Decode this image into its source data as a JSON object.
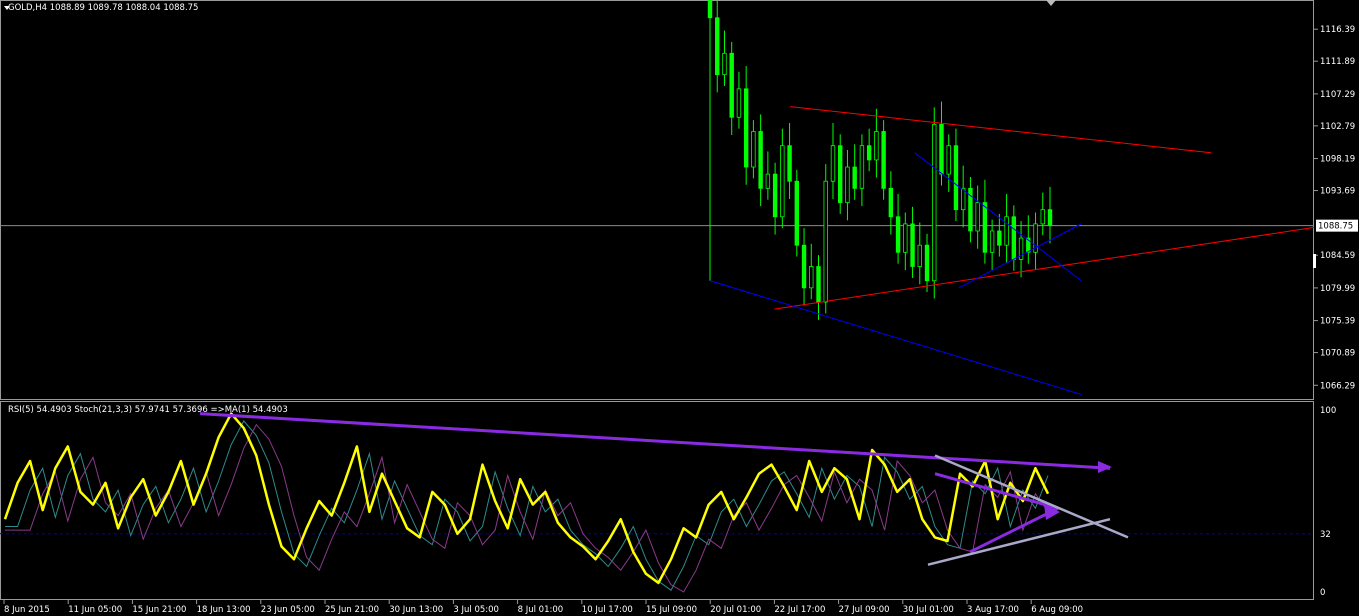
{
  "window": {
    "symbol_label": "GOLD,H4",
    "ohlc": "1088.89 1089.78 1088.04 1088.75",
    "menu_icon": "triangle-down-icon"
  },
  "indicator": {
    "header": "RSI(5) 54.4903  Stoch(21,3,3) 57.9741 57.3696  =>MA(1) 54.4903"
  },
  "colors": {
    "background": "#000000",
    "candle": "#00ff00",
    "rsi": "#ffff00",
    "trend_red": "#ff0000",
    "trend_blue": "#0000ff",
    "trend_purple": "#8a2be2",
    "trend_gray": "#a9a9c9",
    "level_line": "#0000aa"
  },
  "chart_data": [
    {
      "type": "candlestick",
      "title": "GOLD,H4",
      "ylim": [
        1064.5,
        1120.5
      ],
      "y_ticks": [
        "1116.39",
        "1111.89",
        "1107.29",
        "1102.79",
        "1098.19",
        "1093.69",
        "1088.75",
        "1084.59",
        "1079.99",
        "1075.39",
        "1070.89",
        "1066.29"
      ],
      "current_price": "1088.75",
      "x_ticks": [
        "8 Jun 2015",
        "11 Jun 05:00",
        "15 Jun 21:00",
        "18 Jun 13:00",
        "23 Jun 05:00",
        "25 Jun 21:00",
        "30 Jun 13:00",
        "3 Jul 05:00",
        "8 Jul 01:00",
        "10 Jul 17:00",
        "15 Jul 09:00",
        "20 Jul 01:00",
        "22 Jul 17:00",
        "27 Jul 09:00",
        "30 Jul 01:00",
        "3 Aug 17:00",
        "6 Aug 09:00"
      ],
      "price_path": [
        1118,
        1110,
        1113,
        1104,
        1108,
        1097,
        1102,
        1094,
        1096,
        1090,
        1100,
        1095,
        1086,
        1080,
        1083,
        1078,
        1095,
        1100,
        1092,
        1097,
        1094,
        1100,
        1098,
        1102,
        1094,
        1090,
        1085,
        1089,
        1083,
        1086,
        1081,
        1103,
        1096,
        1100,
        1091,
        1094,
        1088,
        1092,
        1085,
        1088,
        1086,
        1090,
        1084,
        1087,
        1085,
        1089,
        1091,
        1088.75
      ],
      "trendlines": [
        {
          "color": "red",
          "from": [
            "22 Jul 17:00",
            1077
          ],
          "to": [
            "right-edge",
            1088.5
          ]
        },
        {
          "color": "red",
          "from": [
            "22 Jul 01:00",
            1105.5
          ],
          "to": [
            "10 Aug",
            1099
          ]
        },
        {
          "color": "blue",
          "from": [
            "20 Jul 01:00",
            1081
          ],
          "to": [
            "8 Aug",
            1065
          ]
        },
        {
          "color": "blue",
          "from": [
            "30 Jul 09:00",
            1099
          ],
          "to": [
            "8 Aug",
            1081
          ]
        },
        {
          "color": "blue",
          "from": [
            "3 Aug 01:00",
            1080
          ],
          "to": [
            "8 Aug",
            1089
          ]
        }
      ]
    },
    {
      "type": "line",
      "title": "RSI(5) 54.4903  Stoch(21,3,3) 57.9741 57.3696  =>MA(1) 54.4903",
      "ylim": [
        0,
        100
      ],
      "y_ticks": [
        "100",
        "32",
        "0"
      ],
      "level": 32,
      "series": [
        {
          "name": "RSI(5)",
          "values": [
            40,
            60,
            72,
            45,
            68,
            80,
            55,
            48,
            60,
            35,
            52,
            62,
            42,
            55,
            72,
            48,
            65,
            85,
            98,
            90,
            75,
            48,
            25,
            18,
            35,
            50,
            42,
            60,
            80,
            44,
            65,
            50,
            35,
            30,
            55,
            48,
            32,
            40,
            70,
            50,
            35,
            62,
            48,
            55,
            38,
            30,
            25,
            18,
            28,
            40,
            22,
            10,
            5,
            18,
            35,
            30,
            48,
            55,
            40,
            52,
            65,
            70,
            58,
            45,
            72,
            55,
            68,
            62,
            40,
            78,
            70,
            55,
            62,
            40,
            30,
            28,
            65,
            58,
            72,
            40,
            60,
            50,
            68,
            54
          ]
        }
      ],
      "trendlines": [
        {
          "color": "purple",
          "from": [
            "18 Jun 13:00",
            98
          ],
          "to": [
            "8 Aug",
            68
          ]
        },
        {
          "color": "purple",
          "from": [
            "3 Aug 01:00",
            22
          ],
          "to": [
            "6 Aug 09:00",
            46
          ]
        },
        {
          "color": "purple",
          "from": [
            "30 Jul 09:00",
            65
          ],
          "to": [
            "6 Aug 09:00",
            46
          ]
        },
        {
          "color": "gray",
          "from": [
            "30 Jul 09:00",
            75
          ],
          "to": [
            "8 Aug",
            30
          ]
        },
        {
          "color": "gray",
          "from": [
            "30 Jul 01:00",
            15
          ],
          "to": [
            "8 Aug",
            40
          ]
        }
      ]
    }
  ]
}
